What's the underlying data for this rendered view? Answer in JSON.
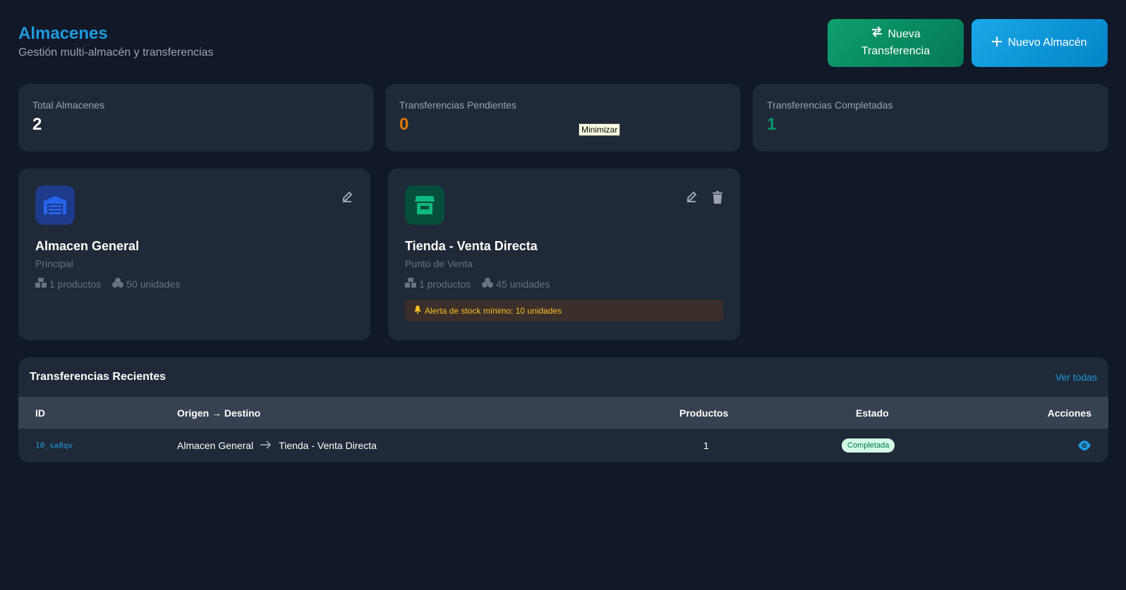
{
  "header": {
    "title": "Almacenes",
    "subtitle": "Gestión multi-almacén y transferencias"
  },
  "actions": {
    "transfer_label_1": "Nueva",
    "transfer_label_2": "Transferencia",
    "new_warehouse_label": "Nuevo Almacén"
  },
  "stats": [
    {
      "label": "Total Almacenes",
      "value": "2",
      "color": "#ffffff"
    },
    {
      "label": "Transferencias Pendientes",
      "value": "0",
      "color": "#d97706"
    },
    {
      "label": "Transferencias Completadas",
      "value": "1",
      "color": "#059669"
    }
  ],
  "tooltip": "Minimizar",
  "warehouses": [
    {
      "name": "Almacen General",
      "type": "Principal",
      "products": "1 productos",
      "units": "50 unidades",
      "icon": "warehouse-icon"
    },
    {
      "name": "Tienda - Venta Directa",
      "type": "Punto de Venta",
      "products": "1 productos",
      "units": "45 unidades",
      "icon": "store-icon",
      "alert": "Alerta de stock mínimo: 10 unidades"
    }
  ],
  "transfers": {
    "title": "Transferencias Recientes",
    "see_all": "Ver todas",
    "columns": {
      "id": "ID",
      "route": "Origen → Destino",
      "products": "Productos",
      "status": "Estado",
      "actions": "Acciones"
    },
    "rows": [
      {
        "id": "10_sa8qv",
        "origin": "Almacen General",
        "destination": "Tienda - Venta Directa",
        "products": "1",
        "status": "Completada"
      }
    ]
  }
}
